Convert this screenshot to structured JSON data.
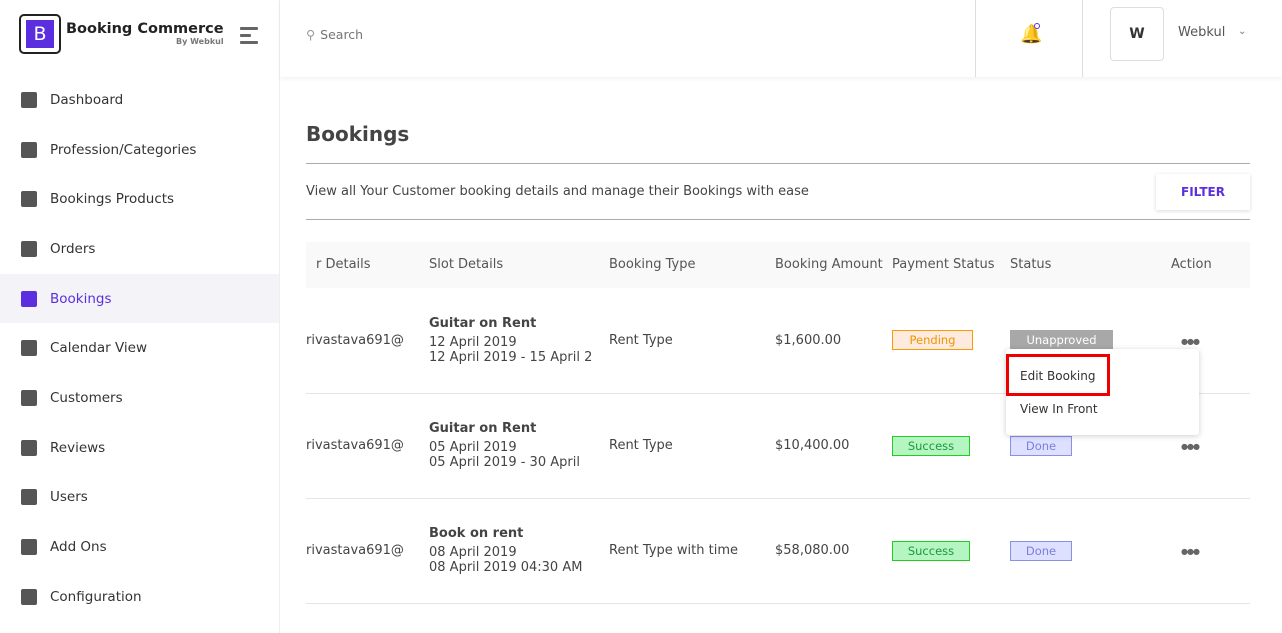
{
  "brand": {
    "title": "Booking Commerce",
    "subtitle": "By Webkul",
    "letter": "B"
  },
  "sidebar": {
    "items": [
      {
        "label": "Dashboard",
        "icon": "dashboard-icon"
      },
      {
        "label": "Profession/Categories",
        "icon": "categories-icon"
      },
      {
        "label": "Bookings Products",
        "icon": "products-icon"
      },
      {
        "label": "Orders",
        "icon": "orders-icon"
      },
      {
        "label": "Bookings",
        "icon": "bookings-icon",
        "active": true
      },
      {
        "label": "Calendar View",
        "icon": "calendar-icon"
      },
      {
        "label": "Customers",
        "icon": "customers-icon"
      },
      {
        "label": "Reviews",
        "icon": "star-icon"
      },
      {
        "label": "Users",
        "icon": "users-icon"
      },
      {
        "label": "Add Ons",
        "icon": "puzzle-icon"
      },
      {
        "label": "Configuration",
        "icon": "gear-icon"
      }
    ]
  },
  "topbar": {
    "search_placeholder": "Search",
    "user_initial": "W",
    "user_name": "Webkul"
  },
  "page": {
    "title": "Bookings",
    "description": "View all Your Customer booking details and manage their Bookings with ease",
    "filter_label": "FILTER"
  },
  "table": {
    "headers": [
      "r Details",
      "Slot Details",
      "Booking Type",
      "Booking Amount",
      "Payment Status",
      "Status",
      "Action"
    ],
    "rows": [
      {
        "customer": "rivastava691@",
        "slot_title": "Guitar on Rent",
        "slot_date": "12 April 2019",
        "slot_range": "12 April 2019 - 15 April 2",
        "type": "Rent Type",
        "amount": "$1,600.00",
        "payment": "Pending",
        "status": "Unapproved"
      },
      {
        "customer": "rivastava691@",
        "slot_title": "Guitar on Rent",
        "slot_date": "05 April 2019",
        "slot_range": "05 April 2019 - 30 April",
        "type": "Rent Type",
        "amount": "$10,400.00",
        "payment": "Success",
        "status": "Done"
      },
      {
        "customer": "rivastava691@",
        "slot_title": "Book on rent",
        "slot_date": "08 April 2019",
        "slot_range": "08 April 2019 04:30 AM",
        "type": "Rent Type with time",
        "amount": "$58,080.00",
        "payment": "Success",
        "status": "Done"
      }
    ]
  },
  "action_menu": {
    "items": [
      "Edit Booking",
      "View In Front"
    ],
    "highlight_color": "#ee0000"
  },
  "colors": {
    "accent": "#5b2fe0"
  }
}
